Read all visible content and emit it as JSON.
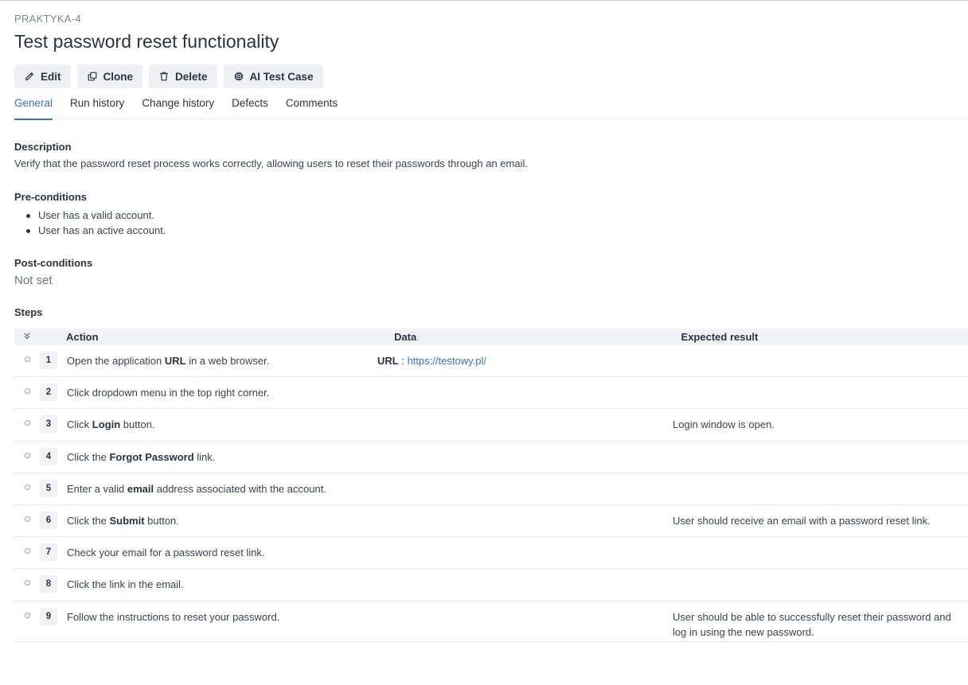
{
  "case": {
    "key": "PRAKTYKA-4",
    "title": "Test password reset functionality"
  },
  "toolbar": {
    "edit": "Edit",
    "clone": "Clone",
    "delete": "Delete",
    "ai_test_case": "AI Test Case"
  },
  "tabs": [
    {
      "label": "General",
      "active": true
    },
    {
      "label": "Run history",
      "active": false
    },
    {
      "label": "Change history",
      "active": false
    },
    {
      "label": "Defects",
      "active": false
    },
    {
      "label": "Comments",
      "active": false
    }
  ],
  "description": {
    "label": "Description",
    "text": "Verify that the password reset process works correctly, allowing users to reset their passwords through an email."
  },
  "preconditions": {
    "label": "Pre-conditions",
    "items": [
      "User has a valid account.",
      "User has an active account."
    ]
  },
  "postconditions": {
    "label": "Post-conditions",
    "value": "Not set"
  },
  "steps": {
    "label": "Steps",
    "headers": {
      "action": "Action",
      "data": "Data",
      "expected": "Expected result"
    },
    "rows": [
      {
        "num": "1",
        "action_pre": "Open the application ",
        "action_bold": "URL",
        "action_post": " in a web browser.",
        "data_key": "URL",
        "data_sep": " : ",
        "data_value": "https://testowy.pl/",
        "expected": ""
      },
      {
        "num": "2",
        "action_pre": "Click dropdown menu in the top right corner.",
        "action_bold": "",
        "action_post": "",
        "data_key": "",
        "data_sep": "",
        "data_value": "",
        "expected": ""
      },
      {
        "num": "3",
        "action_pre": "Click ",
        "action_bold": "Login",
        "action_post": " button.",
        "data_key": "",
        "data_sep": "",
        "data_value": "",
        "expected": "Login window is open."
      },
      {
        "num": "4",
        "action_pre": "Click the ",
        "action_bold": "Forgot Password",
        "action_post": " link.",
        "data_key": "",
        "data_sep": "",
        "data_value": "",
        "expected": ""
      },
      {
        "num": "5",
        "action_pre": "Enter a valid ",
        "action_bold": "email",
        "action_post": " address associated with the account.",
        "data_key": "",
        "data_sep": "",
        "data_value": "",
        "expected": ""
      },
      {
        "num": "6",
        "action_pre": "Click the ",
        "action_bold": "Submit",
        "action_post": " button.",
        "data_key": "",
        "data_sep": "",
        "data_value": "",
        "expected": "User should receive an email with a password reset link."
      },
      {
        "num": "7",
        "action_pre": "Check your email for a password reset link.",
        "action_bold": "",
        "action_post": "",
        "data_key": "",
        "data_sep": "",
        "data_value": "",
        "expected": ""
      },
      {
        "num": "8",
        "action_pre": "Click the link in the email.",
        "action_bold": "",
        "action_post": "",
        "data_key": "",
        "data_sep": "",
        "data_value": "",
        "expected": ""
      },
      {
        "num": "9",
        "action_pre": "Follow the instructions to reset your password.",
        "action_bold": "",
        "action_post": "",
        "data_key": "",
        "data_sep": "",
        "data_value": "",
        "expected": "User should be able to successfully reset their password and log in using the new password."
      }
    ]
  },
  "colors": {
    "accent": "#3b6fc4",
    "text": "#2b3440",
    "muted": "#7b8591",
    "button_bg": "#eef0f3"
  },
  "icons": {
    "edit": "pencil-icon",
    "clone": "copy-icon",
    "delete": "trash-icon",
    "ai": "chip-icon",
    "collapse": "chevrons-down-icon",
    "step": "circle-icon"
  }
}
